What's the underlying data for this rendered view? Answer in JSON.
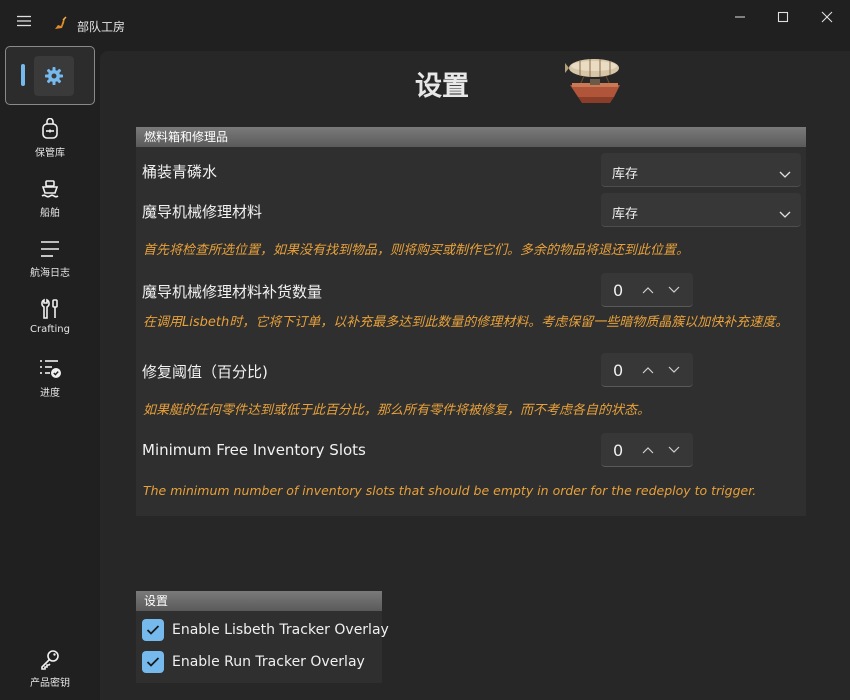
{
  "window": {
    "title": "部队工房"
  },
  "nav": {
    "items": [
      {
        "label": "保管库",
        "icon": "backpack-icon"
      },
      {
        "label": "船舶",
        "icon": "ship-icon"
      },
      {
        "label": "航海日志",
        "icon": "log-list-icon"
      },
      {
        "label": "Crafting",
        "icon": "wrench-screwdriver-icon"
      },
      {
        "label": "进度",
        "icon": "progress-checklist-icon"
      }
    ],
    "footer": {
      "label": "产品密钥",
      "icon": "key-icon"
    },
    "active": "settings",
    "accent": "#76b9ed"
  },
  "page": {
    "title": "设置"
  },
  "fuel_panel": {
    "header": "燃料箱和修理品",
    "rows": {
      "water": {
        "label": "桶装青磷水",
        "value": "库存"
      },
      "material": {
        "label": "魔导机械修理材料",
        "value": "库存"
      },
      "dropdown_note": "首先将检查所选位置，如果没有找到物品，则将购买或制作它们。多余的物品将退还到此位置。",
      "restock": {
        "label": "魔导机械修理材料补货数量",
        "value": "0",
        "note": "在调用Lisbeth时，它将下订单，以补充最多达到此数量的修理材料。考虑保留一些暗物质晶簇以加快补充速度。"
      },
      "threshold": {
        "label": "修复阈值（百分比)",
        "value": "0",
        "note": "如果艇的任何零件达到或低于此百分比，那么所有零件将被修复，而不考虑各自的状态。"
      },
      "slots": {
        "label": "Minimum Free Inventory Slots",
        "value": "0",
        "note": "The minimum number of inventory slots that should be empty in order for the redeploy to trigger."
      }
    },
    "note_color": "#e8a13a"
  },
  "settings_panel": {
    "header": "设置",
    "options": [
      {
        "label": "Enable Lisbeth Tracker Overlay",
        "checked": true
      },
      {
        "label": "Enable Run Tracker Overlay",
        "checked": true
      }
    ]
  }
}
